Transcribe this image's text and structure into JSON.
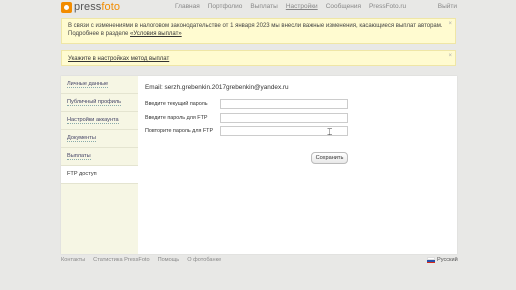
{
  "header": {
    "logo_prefix": "press",
    "logo_suffix": "foto",
    "nav": [
      "Главная",
      "Портфолио",
      "Выплаты",
      "Настройки",
      "Сообщения",
      "PressFoto.ru"
    ],
    "logout": "Выйти"
  },
  "notices": {
    "payout_change_text": "В связи с изменениями в налоговом законодательстве от 1 января 2023 мы внесли важные изменения, касающиеся выплат авторам. Подробнее в разделе ",
    "payout_change_link": "«Условия выплат»",
    "payout_method_link": "Укажите в настройках метод выплат",
    "close_glyph": "×"
  },
  "sidebar": {
    "items": [
      "Личные данные",
      "Публичный профиль",
      "Настройки аккаунта",
      "Документы",
      "Выплаты",
      "FTP доступ"
    ]
  },
  "form": {
    "email_line": "Email: serzh.grebenkin.2017grebenkin@yandex.ru",
    "current_password_label": "Введите текущий пароль",
    "ftp_password_label": "Введите пароль для FTP",
    "repeat_password_label": "Повторите пароль для FTP",
    "save_button": "Сохранить"
  },
  "footer": {
    "links": [
      "Контакты",
      "Статистика PressFoto",
      "Помощь",
      "О фотобанке"
    ],
    "language": "Русский"
  },
  "colors": {
    "accent": "#f28c00",
    "notice_bg": "#fffbd0",
    "sidebar_bg": "#f6f6e4"
  }
}
